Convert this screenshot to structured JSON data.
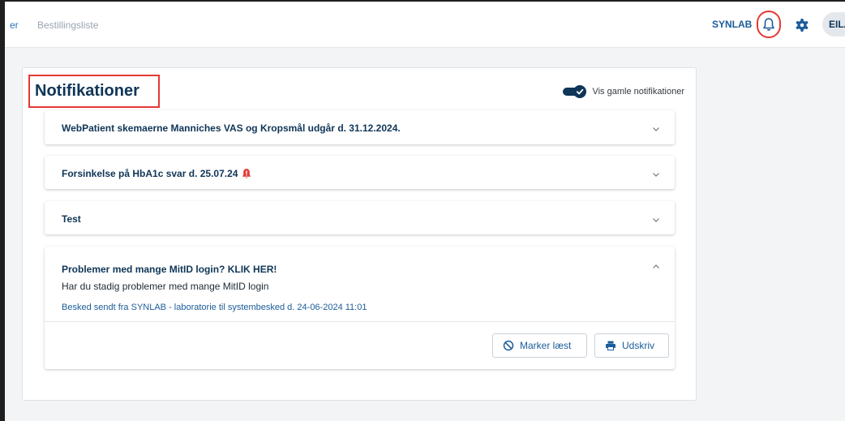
{
  "nav": {
    "partial_item": "er",
    "order_list": "Bestillingsliste"
  },
  "header": {
    "org": "SYNLAB",
    "avatar": "EILA"
  },
  "page": {
    "title": "Notifikationer",
    "toggle_label": "Vis gamle notifikationer",
    "toggle_on": true
  },
  "notifications": [
    {
      "title": "WebPatient skemaerne Manniches VAS og Kropsmål udgår d. 31.12.2024.",
      "expanded": false
    },
    {
      "title": "Forsinkelse på HbA1c svar d. 25.07.24",
      "expanded": false,
      "alert_icon": "alarm-bell-icon"
    },
    {
      "title": "Test",
      "expanded": false
    },
    {
      "title": "Problemer med mange MitID login? KLIK HER!",
      "expanded": true,
      "body": "Har du stadig problemer med mange MitID login",
      "meta": "Besked sendt fra SYNLAB - laboratorie til systembesked d. 24-06-2024 11:01"
    }
  ],
  "actions": {
    "mark_read": "Marker læst",
    "print": "Udskriv"
  },
  "colors": {
    "primary": "#0f3557",
    "link": "#1b5c9a",
    "highlight": "#e53935",
    "background": "#f3f4f6"
  }
}
